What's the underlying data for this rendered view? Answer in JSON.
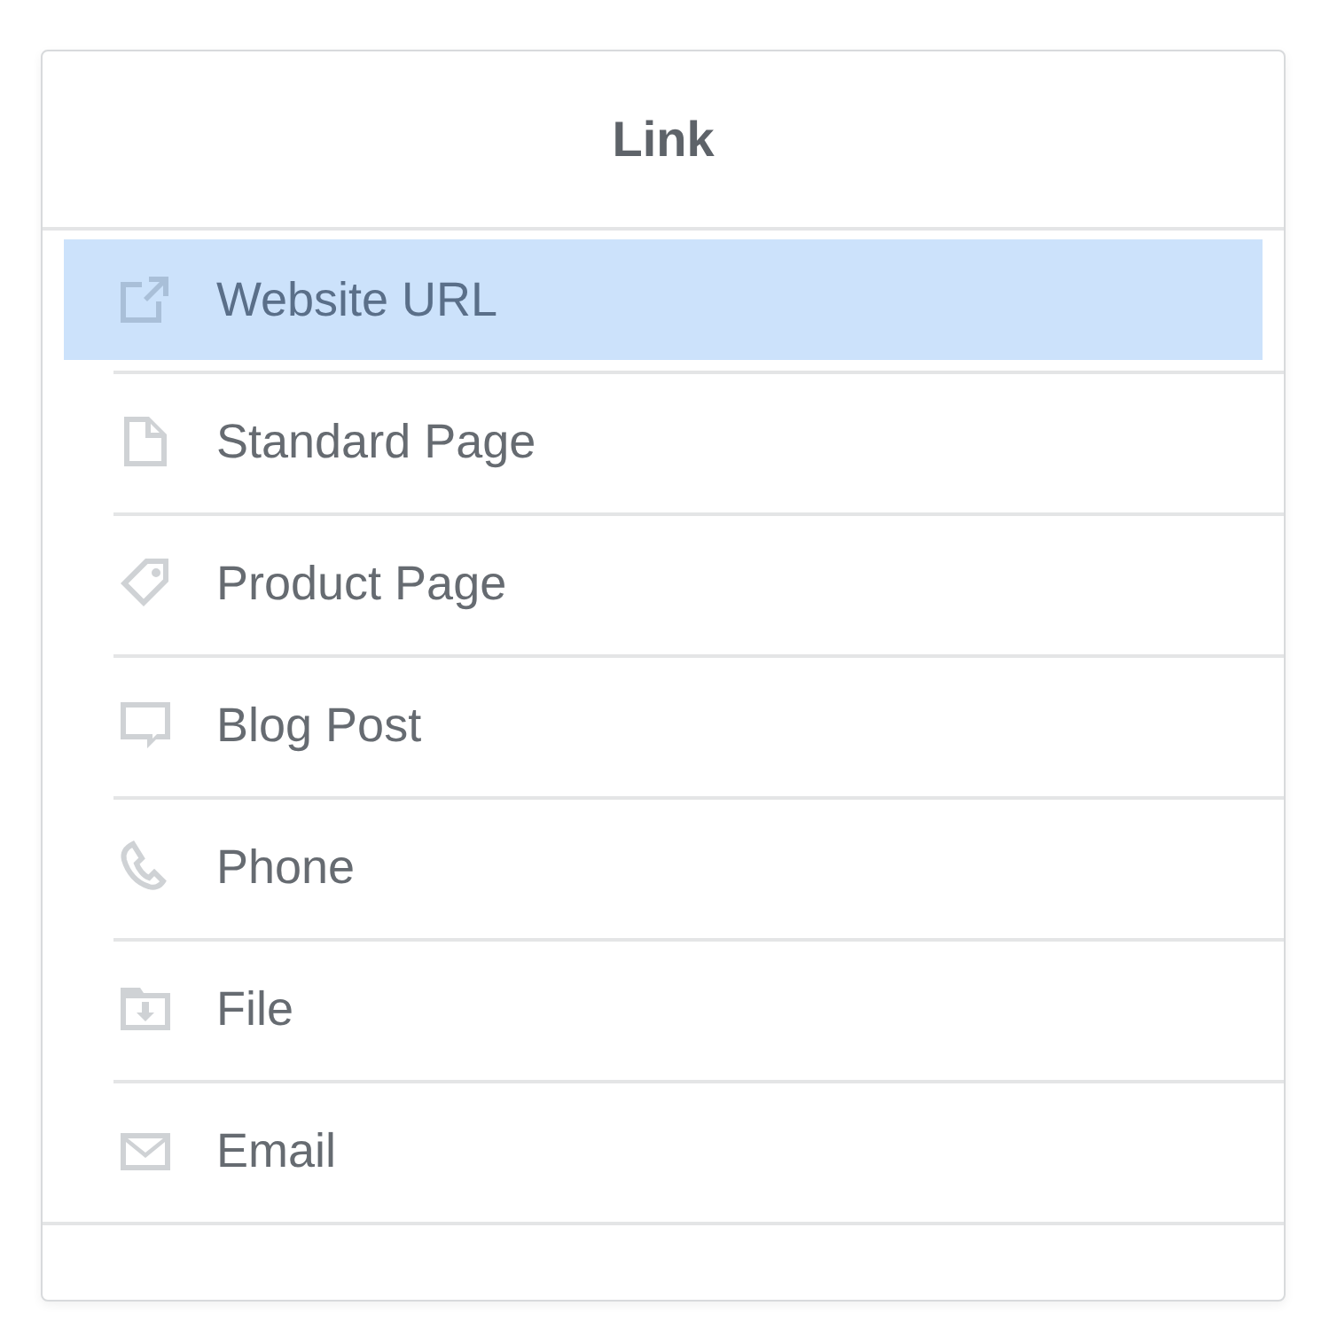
{
  "panel": {
    "title": "Link"
  },
  "items": [
    {
      "label": "Website URL",
      "selected": true
    },
    {
      "label": "Standard Page",
      "selected": false
    },
    {
      "label": "Product Page",
      "selected": false
    },
    {
      "label": "Blog Post",
      "selected": false
    },
    {
      "label": "Phone",
      "selected": false
    },
    {
      "label": "File",
      "selected": false
    },
    {
      "label": "Email",
      "selected": false
    }
  ]
}
